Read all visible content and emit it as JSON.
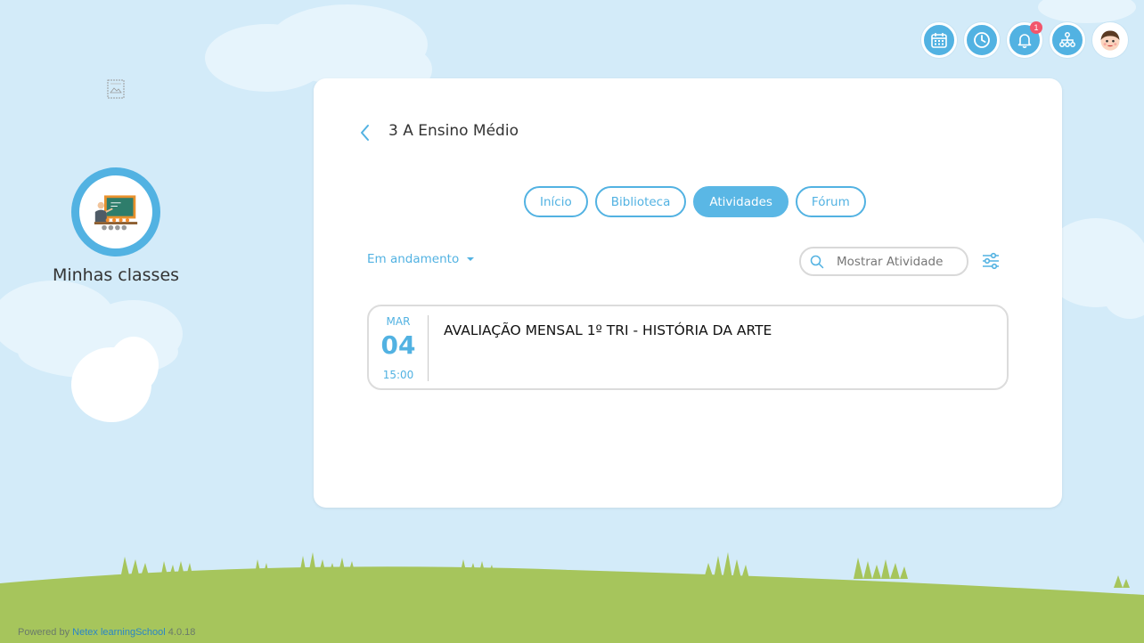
{
  "header": {
    "icons": [
      {
        "name": "calendar-icon"
      },
      {
        "name": "clock-icon"
      },
      {
        "name": "bell-icon",
        "badge": "1"
      },
      {
        "name": "org-chart-icon"
      },
      {
        "name": "user-avatar"
      }
    ]
  },
  "sidebar": {
    "logo": "logo-placeholder",
    "class_icon": "classroom-teacher-icon",
    "label": "Minhas classes"
  },
  "card": {
    "title": "3 A Ensino Médio",
    "tabs": [
      {
        "label": "Início",
        "active": false
      },
      {
        "label": "Biblioteca",
        "active": false
      },
      {
        "label": "Atividades",
        "active": true
      },
      {
        "label": "Fórum",
        "active": false
      }
    ],
    "filter": {
      "label": "Em andamento"
    },
    "search": {
      "placeholder": "Mostrar Atividade",
      "value": ""
    },
    "activities": [
      {
        "month": "MAR",
        "day": "04",
        "time": "15:00",
        "title": "AVALIAÇÃO MENSAL 1º TRI - HISTÓRIA DA ARTE"
      }
    ]
  },
  "footer": {
    "powered_by": "Powered by",
    "brand": "Netex learningSchool",
    "version": "4.0.18"
  },
  "colors": {
    "accent": "#52b2e2",
    "sky": "#d3ebf9",
    "grass": "#a6c55c",
    "badge": "#f2556b"
  }
}
